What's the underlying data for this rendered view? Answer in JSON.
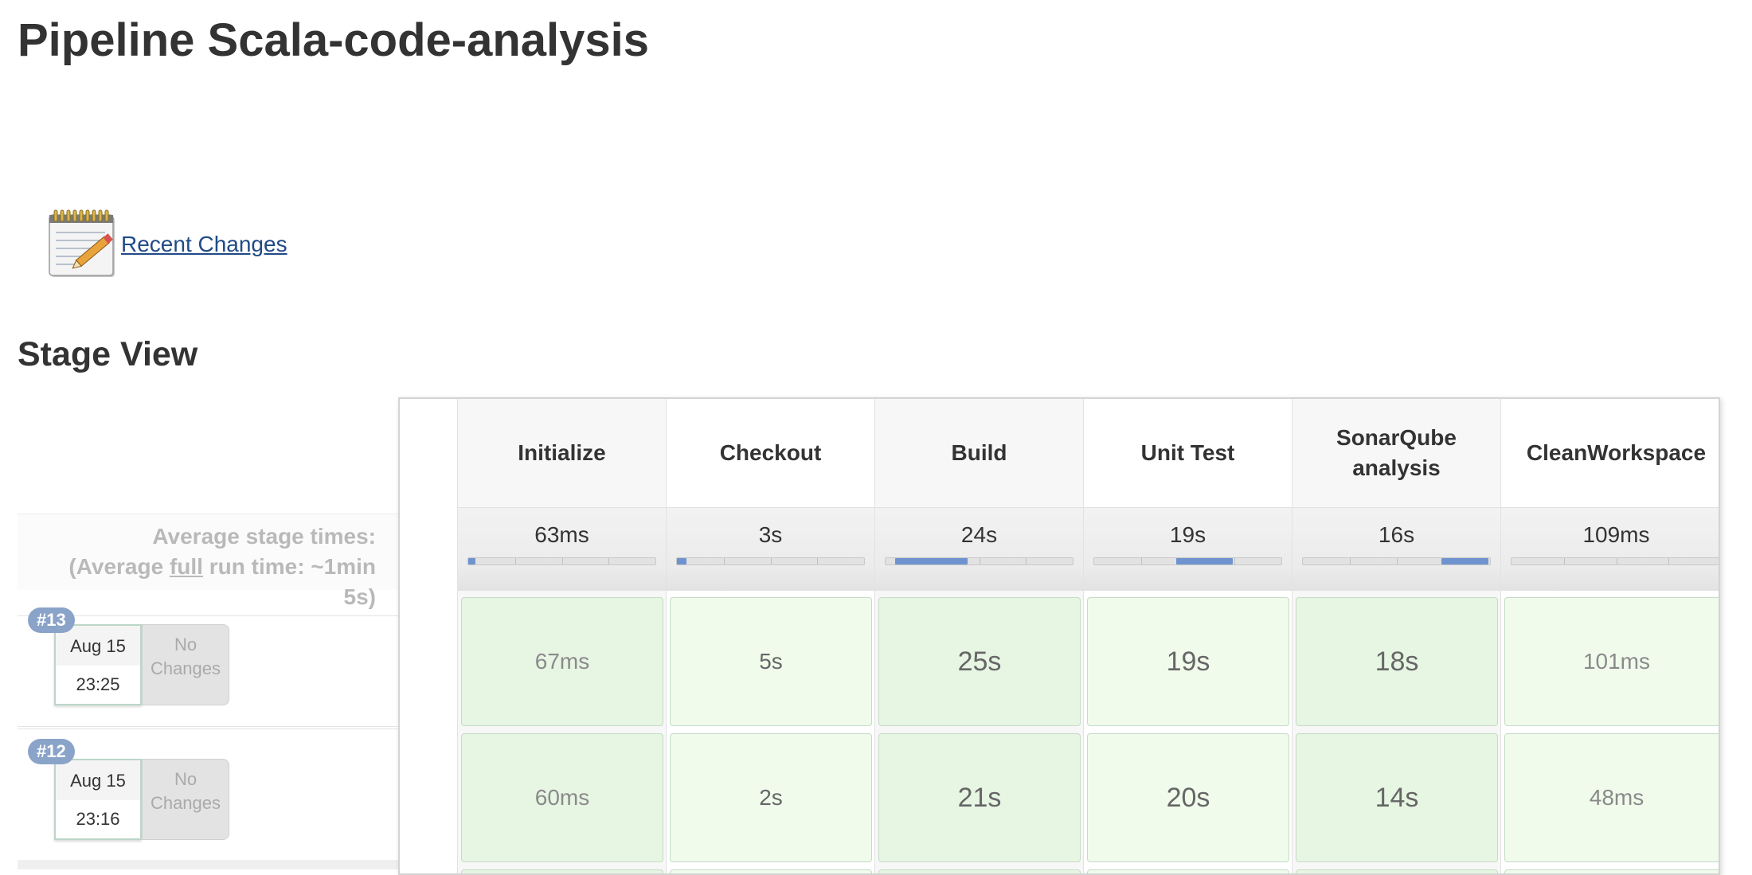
{
  "page": {
    "title": "Pipeline Scala-code-analysis"
  },
  "recent_changes": {
    "icon": "notepad-icon",
    "label": "Recent Changes"
  },
  "stage_view": {
    "title": "Stage View",
    "avg_label_line1": "Average stage times:",
    "avg_label_line2_prefix": "(Average ",
    "avg_label_line2_full": "full",
    "avg_label_line2_suffix": " run time: ~1min",
    "avg_label_line3": "5s)",
    "colors": {
      "success_light": "#f0fbec",
      "success_dark": "#e7f5e3",
      "bar_fill": "#6e93cf",
      "badge": "#8aa3c8"
    },
    "stages": [
      {
        "name": "Initialize",
        "avg": "63ms",
        "bar_start": 0.0,
        "bar_end": 0.04
      },
      {
        "name": "Checkout",
        "avg": "3s",
        "bar_start": 0.0,
        "bar_end": 0.05
      },
      {
        "name": "Build",
        "avg": "24s",
        "bar_start": 0.05,
        "bar_end": 0.44
      },
      {
        "name": "Unit Test",
        "avg": "19s",
        "bar_start": 0.44,
        "bar_end": 0.74
      },
      {
        "name": "SonarQube analysis",
        "avg": "16s",
        "bar_start": 0.74,
        "bar_end": 0.99
      },
      {
        "name": "CleanWorkspace",
        "avg": "109ms",
        "bar_start": 0.99,
        "bar_end": 1.0
      }
    ],
    "runs": [
      {
        "id": "#13",
        "date": "Aug 15",
        "time": "23:25",
        "changes": "No Changes",
        "durations": [
          "67ms",
          "5s",
          "25s",
          "19s",
          "18s",
          "101ms"
        ]
      },
      {
        "id": "#12",
        "date": "Aug 15",
        "time": "23:16",
        "changes": "No Changes",
        "durations": [
          "60ms",
          "2s",
          "21s",
          "20s",
          "14s",
          "48ms"
        ]
      }
    ]
  }
}
